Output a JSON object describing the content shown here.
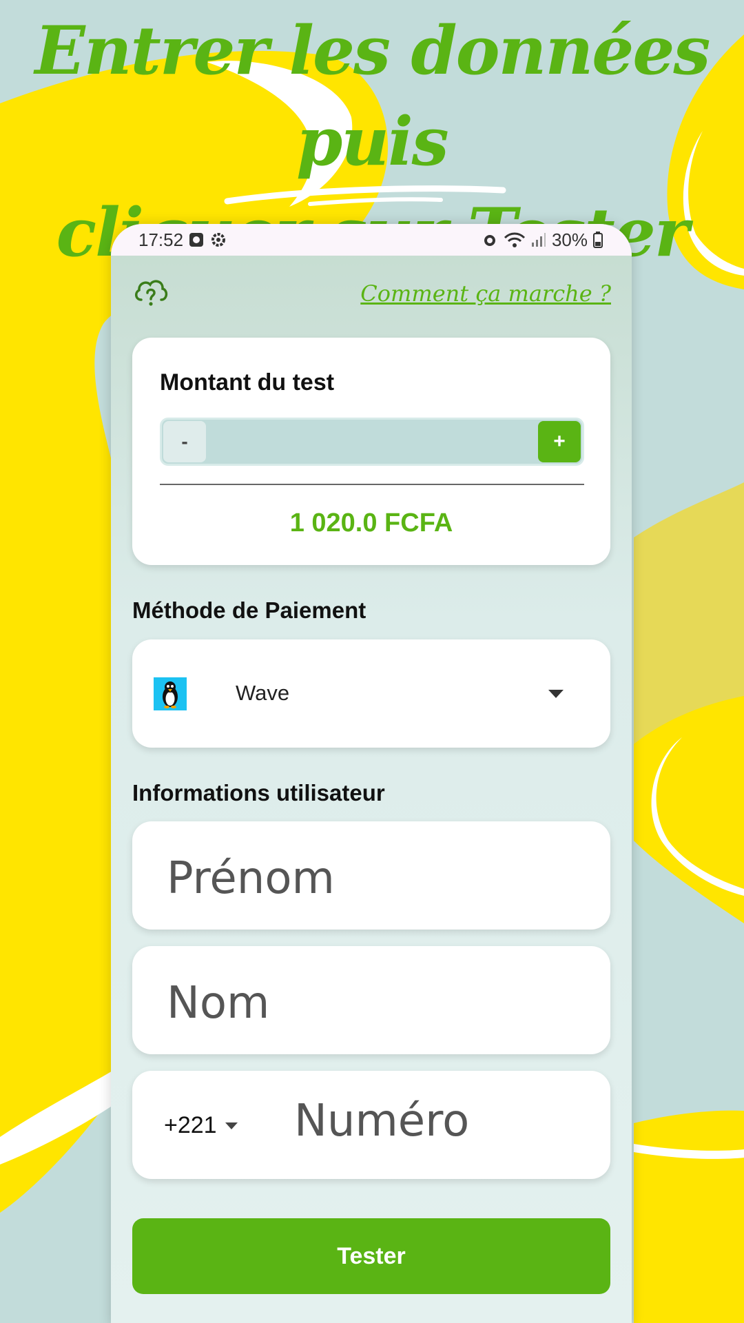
{
  "headline": {
    "line1": "Entrer les données puis",
    "line2": "cliquer sur Tester"
  },
  "statusbar": {
    "time": "17:52",
    "battery": "30%"
  },
  "topbar": {
    "howto_link": "Comment ça marche ?"
  },
  "amount": {
    "title": "Montant du test",
    "minus_label": "-",
    "plus_label": "+",
    "value": "1 020.0 FCFA"
  },
  "payment": {
    "section_label": "Méthode de Paiement",
    "selected_method": "Wave",
    "selected_icon": "penguin-logo-icon"
  },
  "user": {
    "section_label": "Informations utilisateur",
    "firstname_placeholder": "Prénom",
    "lastname_placeholder": "Nom",
    "country_code": "+221",
    "phone_placeholder": "Numéro"
  },
  "submit_label": "Tester",
  "colors": {
    "accent": "#5ab414",
    "background": "#c2dcda",
    "yellow": "#ffe500"
  }
}
